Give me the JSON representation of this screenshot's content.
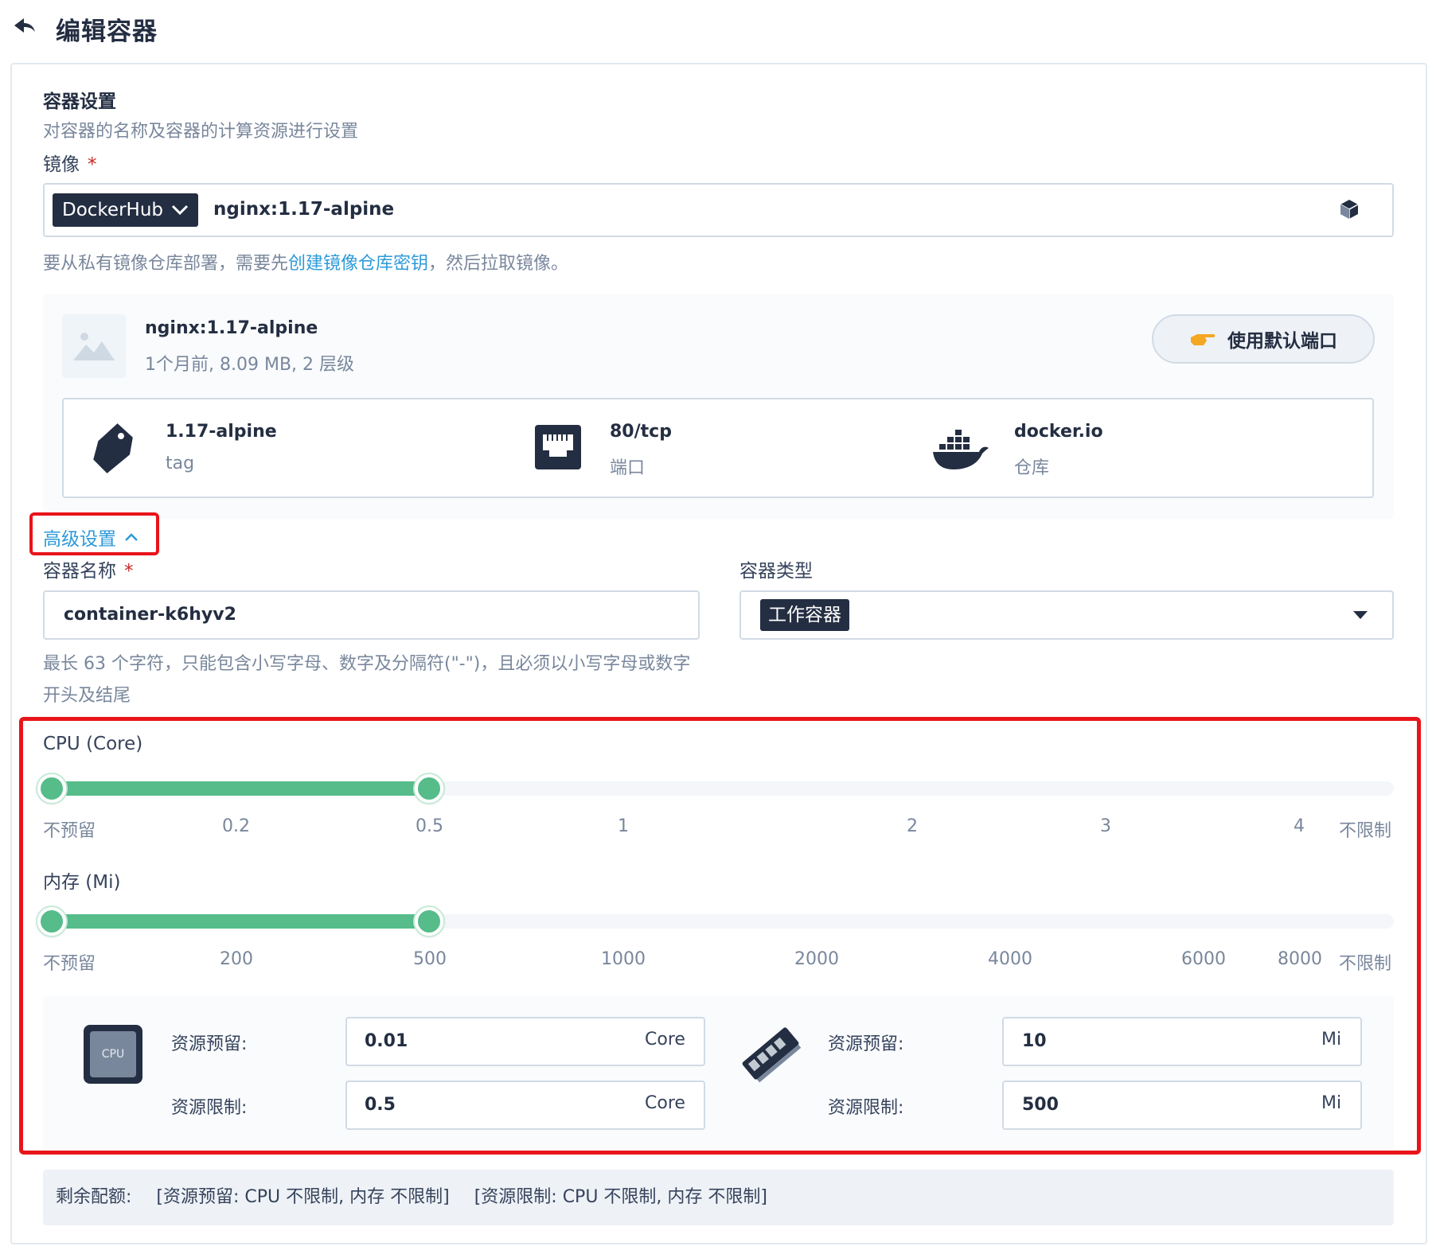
{
  "header": {
    "title": "编辑容器"
  },
  "section": {
    "title": "容器设置",
    "description": "对容器的名称及容器的计算资源进行设置"
  },
  "image": {
    "label": "镜像",
    "required_mark": "*",
    "registry": "DockerHub",
    "value": "nginx:1.17-alpine",
    "hint_prefix": "要从私有镜像仓库部署，需要先",
    "hint_link": "创建镜像仓库密钥",
    "hint_suffix": "，然后拉取镜像。"
  },
  "image_card": {
    "name": "nginx:1.17-alpine",
    "meta": "1个月前, 8.09 MB, 2 层级",
    "use_default_ports": "使用默认端口",
    "tag_value": "1.17-alpine",
    "tag_label": "tag",
    "port_value": "80/tcp",
    "port_label": "端口",
    "repo_value": "docker.io",
    "repo_label": "仓库"
  },
  "advanced": {
    "label": "高级设置"
  },
  "container_name": {
    "label": "容器名称",
    "required_mark": "*",
    "value": "container-k6hyv2",
    "hint": "最长 63 个字符，只能包含小写字母、数字及分隔符(\"-\")，且必须以小写字母或数字开头及结尾"
  },
  "container_type": {
    "label": "容器类型",
    "value": "工作容器"
  },
  "cpu": {
    "label": "CPU (Core)",
    "ticks": [
      "不预留",
      "0.2",
      "0.5",
      "1",
      "2",
      "3",
      "4",
      "不限制"
    ],
    "range": [
      "不预留",
      "0.5"
    ]
  },
  "memory": {
    "label": "内存 (Mi)",
    "ticks": [
      "不预留",
      "200",
      "500",
      "1000",
      "2000",
      "4000",
      "6000",
      "8000",
      "不限制"
    ],
    "range": [
      "不预留",
      "500"
    ]
  },
  "resources": {
    "cpu_icon_text": "CPU",
    "cpu_request_label": "资源预留:",
    "cpu_request_value": "0.01",
    "cpu_request_unit": "Core",
    "cpu_limit_label": "资源限制:",
    "cpu_limit_value": "0.5",
    "cpu_limit_unit": "Core",
    "mem_request_label": "资源预留:",
    "mem_request_value": "10",
    "mem_request_unit": "Mi",
    "mem_limit_label": "资源限制:",
    "mem_limit_value": "500",
    "mem_limit_unit": "Mi"
  },
  "quota": {
    "label": "剩余配额:",
    "requests": "[资源预留: CPU 不限制, 内存 不限制]",
    "limits": "[资源限制: CPU 不限制, 内存 不限制]"
  },
  "colors": {
    "accent_green": "#55bc8a",
    "link_blue": "#2d9ad8",
    "highlight_red": "#e8141a",
    "dark": "#242e42"
  }
}
